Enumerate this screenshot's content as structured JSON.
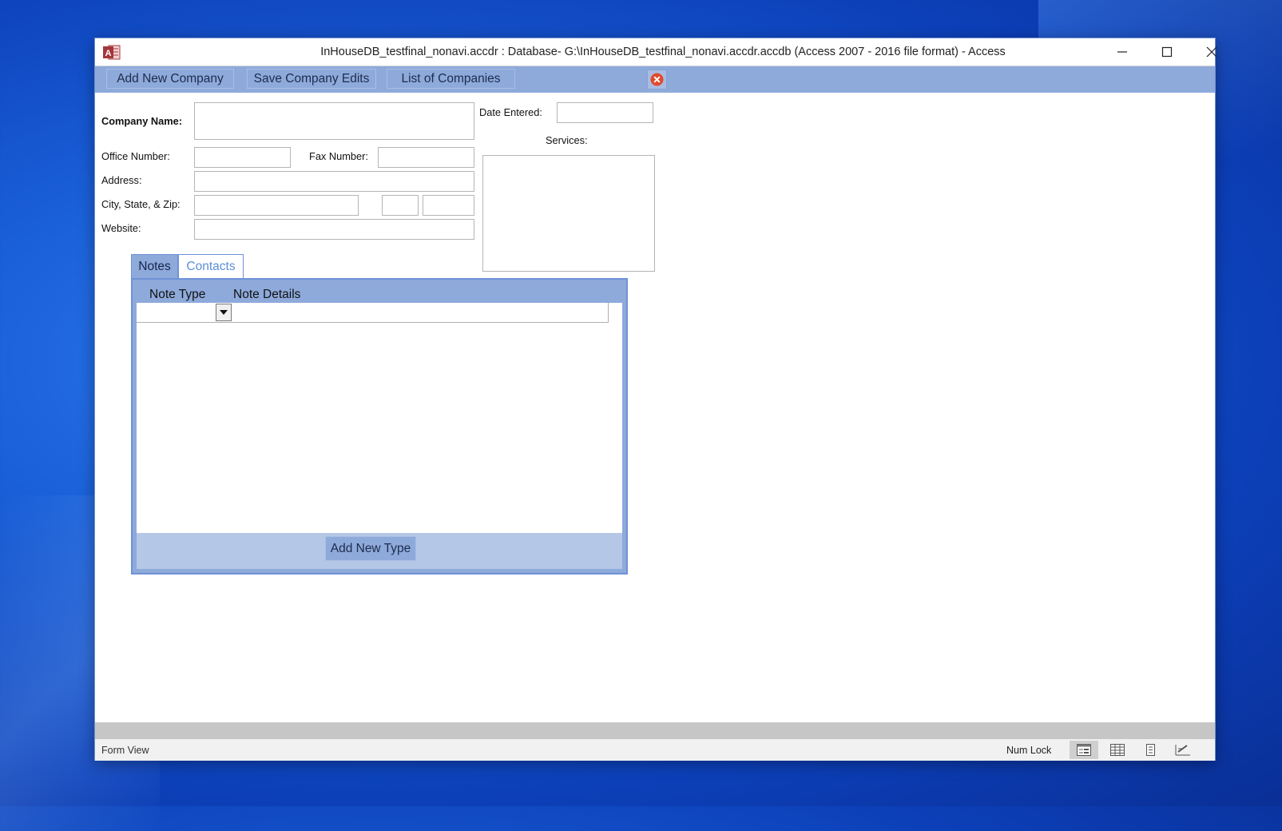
{
  "window": {
    "title": "InHouseDB_testfinal_nonavi.accdr : Database- G:\\InHouseDB_testfinal_nonavi.accdr.accdb (Access 2007 - 2016 file format) - Access",
    "app_icon": "access-icon"
  },
  "toolbar": {
    "add_new_company": "Add New Company",
    "save_company_edits": "Save Company Edits",
    "list_of_companies": "List of Companies"
  },
  "form": {
    "company_name_label": "Company Name:",
    "date_entered_label": "Date Entered:",
    "services_label": "Services:",
    "office_number_label": "Office Number:",
    "fax_number_label": "Fax Number:",
    "address_label": "Address:",
    "city_state_zip_label": "City, State, & Zip:",
    "website_label": "Website:"
  },
  "tabs": [
    {
      "label": "Notes",
      "active": true
    },
    {
      "label": "Contacts",
      "active": false
    }
  ],
  "notes_subform": {
    "columns": [
      "Note Type",
      "Note Details"
    ],
    "add_new_type": "Add New Type"
  },
  "status": {
    "view": "Form View",
    "num_lock": "Num Lock"
  },
  "colors": {
    "accent": "#8eaadb",
    "accent_light": "#b4c7e7",
    "close_red": "#e04a2f",
    "inactive_tab_text": "#5b8fd9"
  }
}
